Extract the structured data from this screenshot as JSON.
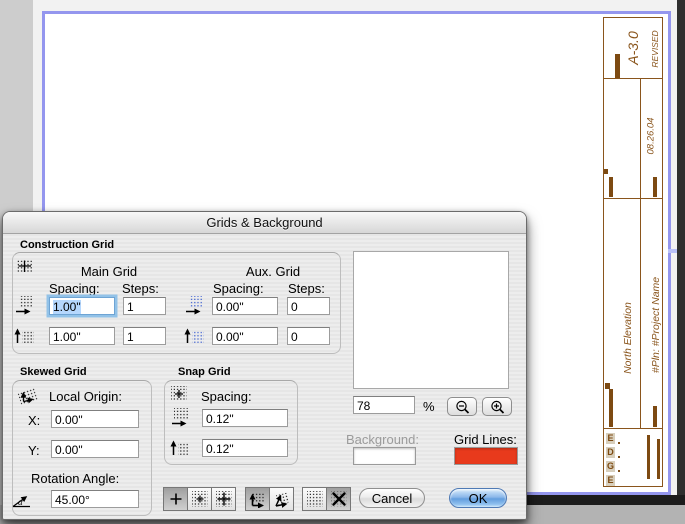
{
  "window": {
    "title": "Grids & Background"
  },
  "construction": {
    "section": "Construction Grid",
    "main_heading": "Main Grid",
    "aux_heading": "Aux. Grid",
    "spacing_label": "Spacing:",
    "steps_label": "Steps:",
    "main": {
      "h_spacing": "1.00\"",
      "h_steps": "1",
      "v_spacing": "1.00\"",
      "v_steps": "1"
    },
    "aux": {
      "h_spacing": "0.00\"",
      "h_steps": "0",
      "v_spacing": "0.00\"",
      "v_steps": "0"
    }
  },
  "skewed": {
    "section": "Skewed Grid",
    "origin_label": "Local Origin:",
    "x_label": "X:",
    "x_value": "0.00\"",
    "y_label": "Y:",
    "y_value": "0.00\"",
    "rotation_label": "Rotation Angle:",
    "rotation_value": "45.00°"
  },
  "snap": {
    "section": "Snap Grid",
    "spacing_label": "Spacing:",
    "h_value": "0.12\"",
    "v_value": "0.12\""
  },
  "preview": {
    "zoom_value": "78",
    "percent": "%"
  },
  "colors": {
    "background_label": "Background:",
    "background_color": "#ffffff",
    "grid_lines_label": "Grid Lines:",
    "grid_lines_color": "#e83a1c",
    "sheet_border": "#9496ee",
    "titleblock_brown": "#8a551c"
  },
  "actions": {
    "cancel": "Cancel",
    "ok": "OK"
  },
  "titleblock": {
    "sheet": "A-3.0",
    "revised": "REVISED",
    "date": "08.26.04",
    "drawing_title": "North Elevation",
    "project": "#Pln: #Project Name",
    "firm": [
      "E",
      "D",
      "G",
      "E"
    ]
  },
  "icons": {
    "construction-grid-icon": "dotted grid with plus",
    "h-spacing-grid-icon": "dotted grid with right arrow",
    "v-spacing-grid-icon": "dotted grid with up arrow",
    "skewed-grid-icon": "skewed dotted grid with axes arrows",
    "snap-grid-icon": "dotted grid with small plus",
    "rotation-angle-icon": "angle with alpha",
    "zoom-out-icon": "magnifier minus",
    "zoom-in-icon": "magnifier plus",
    "grid-display-plus": "plus",
    "grid-display-dots-plus": "dots with small plus",
    "grid-display-dots-bigplus": "dots with large plus",
    "grid-ortho-axes": "orthogonal axes arrows",
    "grid-skew-axes": "skewed axes arrows",
    "grid-dots-only": "dots",
    "grid-off-x": "bold X"
  }
}
